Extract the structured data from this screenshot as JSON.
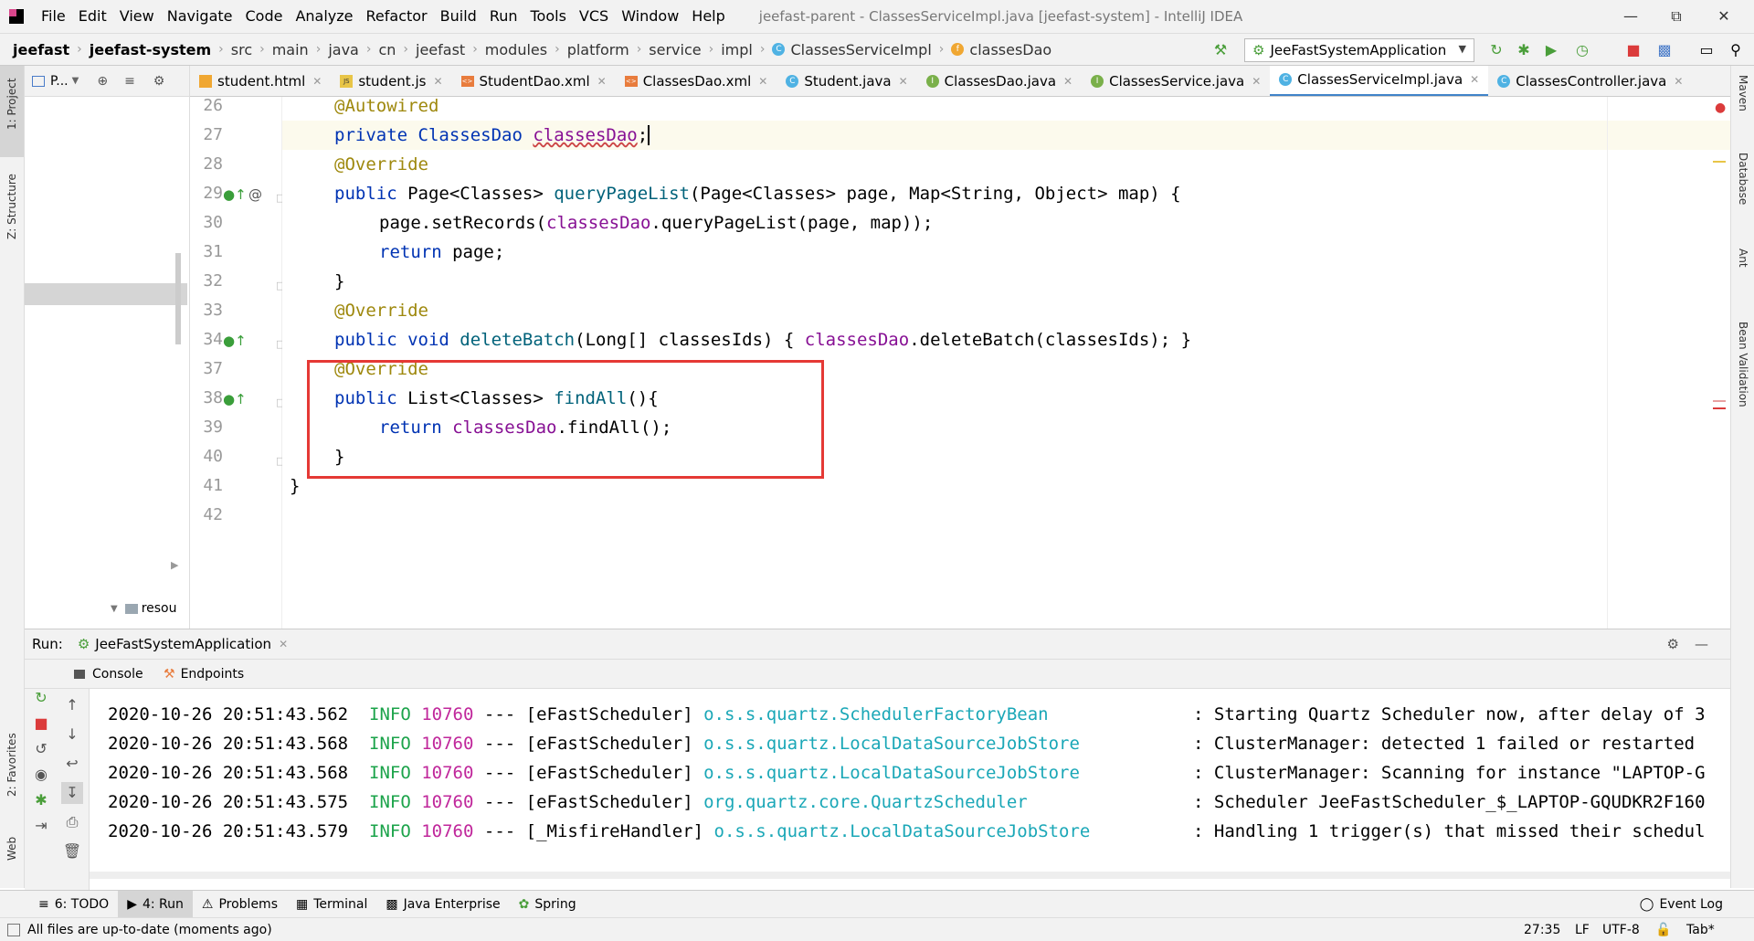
{
  "menubar": {
    "items": [
      "File",
      "Edit",
      "View",
      "Navigate",
      "Code",
      "Analyze",
      "Refactor",
      "Build",
      "Run",
      "Tools",
      "VCS",
      "Window",
      "Help"
    ],
    "title": "jeefast-parent - ClassesServiceImpl.java [jeefast-system] - IntelliJ IDEA"
  },
  "navbar": {
    "crumbs": [
      "jeefast",
      "jeefast-system",
      "src",
      "main",
      "java",
      "cn",
      "jeefast",
      "modules",
      "platform",
      "service",
      "impl",
      "ClassesServiceImpl",
      "classesDao"
    ],
    "run_config": "JeeFastSystemApplication"
  },
  "left_strip": {
    "project": "1: Project",
    "structure": "Z: Structure",
    "favorites": "2: Favorites",
    "web": "Web"
  },
  "right_strip": {
    "maven": "Maven",
    "database": "Database",
    "ant": "Ant",
    "bean": "Bean Validation"
  },
  "project_panel": {
    "title": "P...",
    "tree_item": "resou"
  },
  "tabs": [
    {
      "label": "student.html",
      "icon": "html"
    },
    {
      "label": "student.js",
      "icon": "js"
    },
    {
      "label": "StudentDao.xml",
      "icon": "xml"
    },
    {
      "label": "ClassesDao.xml",
      "icon": "xml"
    },
    {
      "label": "Student.java",
      "icon": "class"
    },
    {
      "label": "ClassesDao.java",
      "icon": "interface"
    },
    {
      "label": "ClassesService.java",
      "icon": "interface"
    },
    {
      "label": "ClassesServiceImpl.java",
      "icon": "class",
      "active": true
    },
    {
      "label": "ClassesController.java",
      "icon": "class"
    }
  ],
  "code": {
    "line_numbers": [
      "26",
      "27",
      "28",
      "29",
      "30",
      "31",
      "32",
      "33",
      "34",
      "37",
      "38",
      "39",
      "40",
      "41",
      "42"
    ],
    "l26": "@Autowired",
    "l27_a": "private ClassesDao ",
    "l27_b": "classesDao",
    "l27_c": ";",
    "l28": "@Override",
    "l29_a": "public ",
    "l29_b": "Page<Classes> ",
    "l29_c": "queryPageList",
    "l29_d": "(Page<Classes> page, Map<String, Object> map) {",
    "l30_a": "page.setRecords(",
    "l30_b": "classesDao",
    "l30_c": ".queryPageList(page, map));",
    "l31_a": "return ",
    "l31_b": "page;",
    "l32": "}",
    "l33": "@Override",
    "l34_a": "public void ",
    "l34_b": "deleteBatch",
    "l34_c": "(Long[] classesIds) { ",
    "l34_d": "classesDao",
    "l34_e": ".deleteBatch(classesIds); }",
    "l37": "@Override",
    "l38_a": "public ",
    "l38_b": "List<Classes> ",
    "l38_c": "findAll",
    "l38_d": "(){",
    "l39_a": "return ",
    "l39_b": "classesDao",
    "l39_c": ".findAll();",
    "l40": "}",
    "l41": "}"
  },
  "run_panel": {
    "label": "Run:",
    "config": "JeeFastSystemApplication",
    "console_tab": "Console",
    "endpoints_tab": "Endpoints"
  },
  "logs": [
    {
      "ts": "2020-10-26 20:51:43.562",
      "level": "INFO",
      "pid": "10760",
      "thread": "--- [eFastScheduler]",
      "logger": "o.s.s.quartz.SchedulerFactoryBean",
      "msg": ": Starting Quartz Scheduler now, after delay of 3"
    },
    {
      "ts": "2020-10-26 20:51:43.568",
      "level": "INFO",
      "pid": "10760",
      "thread": "--- [eFastScheduler]",
      "logger": "o.s.s.quartz.LocalDataSourceJobStore",
      "msg": ": ClusterManager: detected 1 failed or restarted"
    },
    {
      "ts": "2020-10-26 20:51:43.568",
      "level": "INFO",
      "pid": "10760",
      "thread": "--- [eFastScheduler]",
      "logger": "o.s.s.quartz.LocalDataSourceJobStore",
      "msg": ": ClusterManager: Scanning for instance \"LAPTOP-G"
    },
    {
      "ts": "2020-10-26 20:51:43.575",
      "level": "INFO",
      "pid": "10760",
      "thread": "--- [eFastScheduler]",
      "logger": "org.quartz.core.QuartzScheduler",
      "msg": ": Scheduler JeeFastScheduler_$_LAPTOP-GQUDKR2F160"
    },
    {
      "ts": "2020-10-26 20:51:43.579",
      "level": "INFO",
      "pid": "10760",
      "thread": "--- [_MisfireHandler]",
      "logger": "o.s.s.quartz.LocalDataSourceJobStore",
      "msg": ": Handling 1 trigger(s) that missed their schedul"
    }
  ],
  "bottom_tools": [
    "6: TODO",
    "4: Run",
    "Problems",
    "Terminal",
    "Java Enterprise",
    "Spring"
  ],
  "event_log": "Event Log",
  "status": {
    "message": "All files are up-to-date (moments ago)",
    "position": "27:35",
    "line_sep": "LF",
    "encoding": "UTF-8",
    "indent": "Tab*"
  }
}
